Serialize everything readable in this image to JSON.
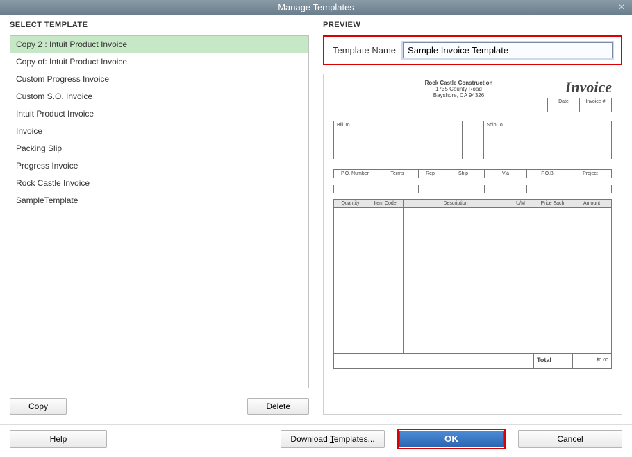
{
  "window": {
    "title": "Manage Templates"
  },
  "left": {
    "heading": "SELECT TEMPLATE",
    "templates": [
      "Copy 2 : Intuit Product Invoice",
      "Copy of: Intuit Product Invoice",
      "Custom Progress Invoice",
      "Custom S.O. Invoice",
      "Intuit Product Invoice",
      "Invoice",
      "Packing Slip",
      "Progress Invoice",
      "Rock Castle Invoice",
      "SampleTemplate"
    ],
    "selected_index": 0,
    "copy_label": "Copy",
    "delete_label": "Delete"
  },
  "right": {
    "heading": "PREVIEW",
    "name_label": "Template Name",
    "name_value": "Sample Invoice Template"
  },
  "preview": {
    "company_name": "Rock Castle Construction",
    "company_addr1": "1735 County Road",
    "company_addr2": "Bayshore, CA 94326",
    "doc_title": "Invoice",
    "meta_headers": [
      "Date",
      "Invoice #"
    ],
    "bill_to_label": "Bill To",
    "ship_to_label": "Ship To",
    "row1_headers": [
      "P.O. Number",
      "Terms",
      "Rep",
      "Ship",
      "Via",
      "F.O.B.",
      "Project"
    ],
    "row2_headers": [
      "Quantity",
      "Item Code",
      "Description",
      "U/M",
      "Price Each",
      "Amount"
    ],
    "total_label": "Total",
    "total_value": "$0.00"
  },
  "footer": {
    "help_label": "Help",
    "download_prefix": "Download ",
    "download_underline": "T",
    "download_suffix": "emplates...",
    "ok_label": "OK",
    "cancel_label": "Cancel"
  }
}
